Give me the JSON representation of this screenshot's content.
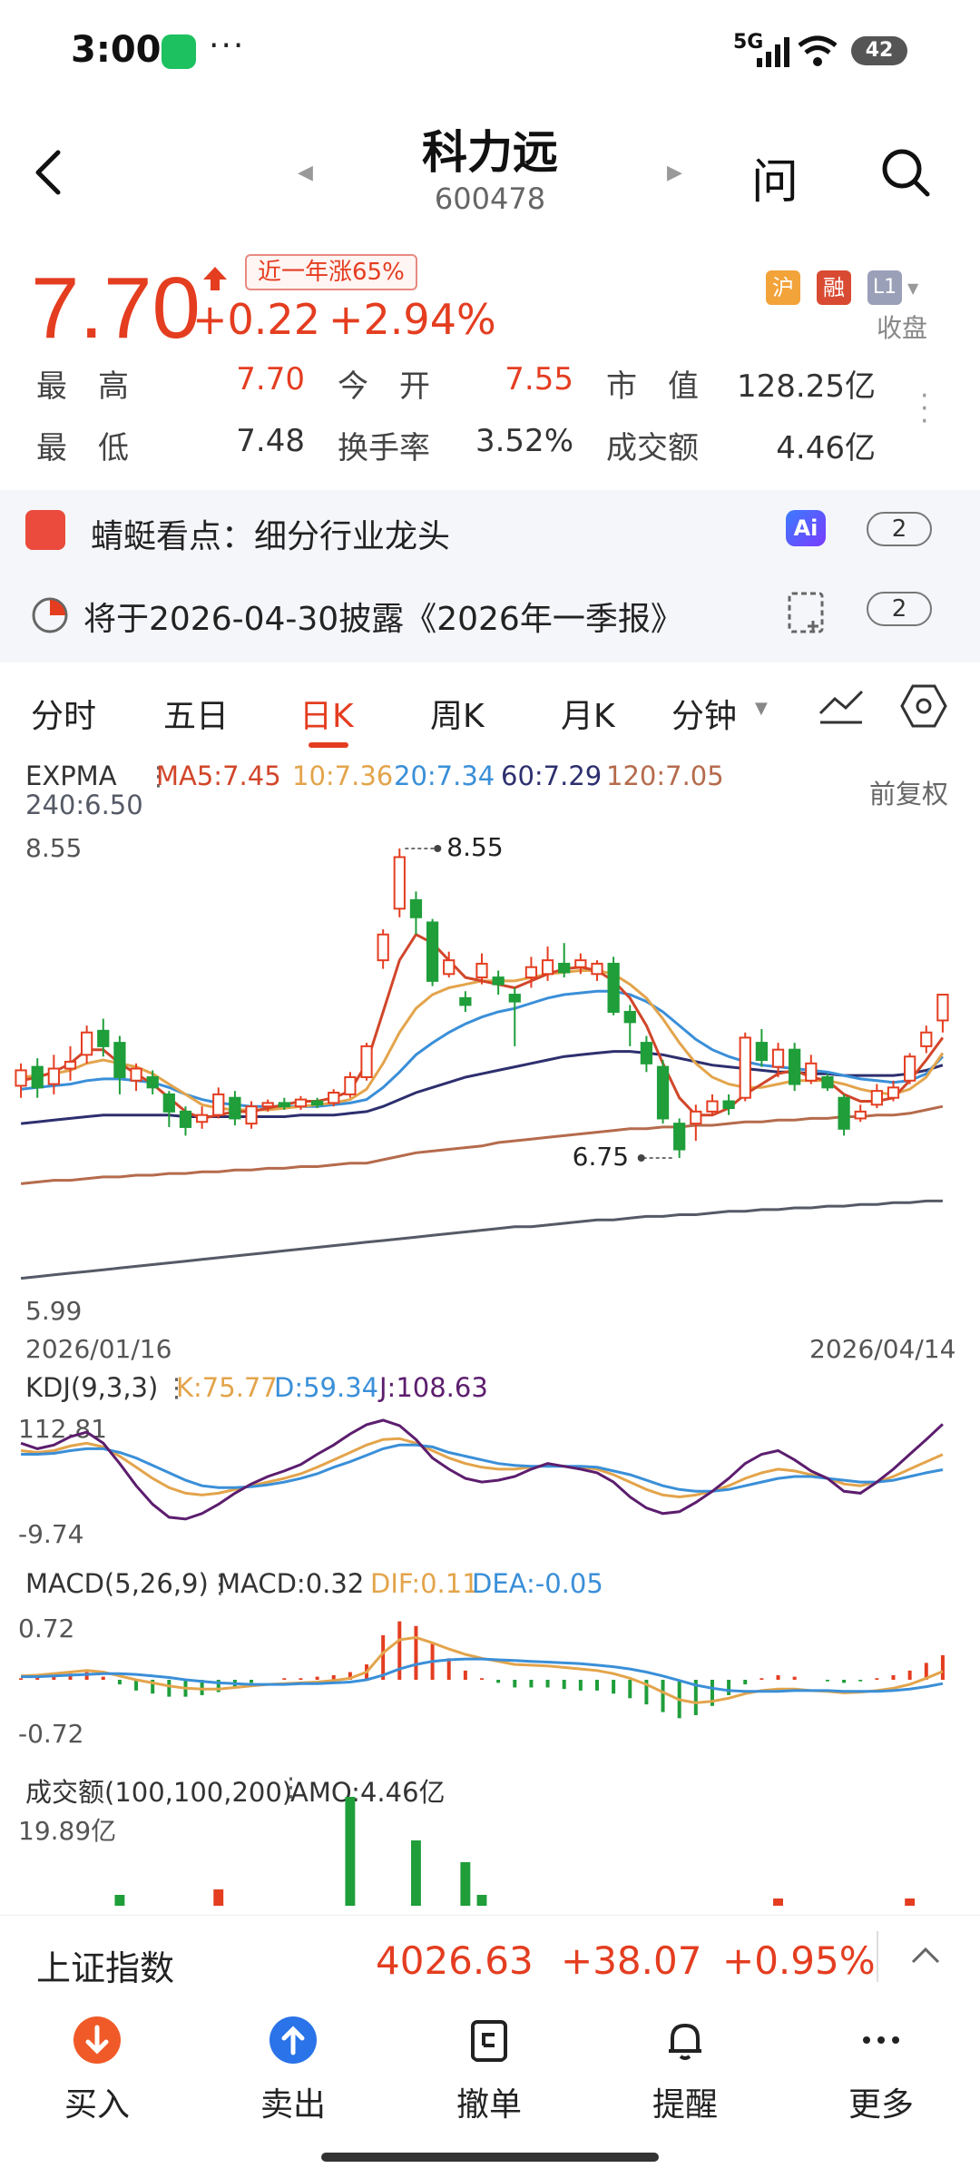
{
  "status": {
    "time": "3:00",
    "network": "5G",
    "battery": "42"
  },
  "header": {
    "name": "科力远",
    "code": "600478",
    "ask": "问"
  },
  "quote": {
    "price": "7.70",
    "year_tag": "近一年涨65%",
    "change": "+0.22",
    "change_pct": "+2.94%",
    "tags": [
      "沪",
      "融",
      "L1"
    ],
    "close_status": "收盘",
    "stats": [
      {
        "label": "最　高",
        "value": "7.70",
        "color": "#e43d20"
      },
      {
        "label": "今　开",
        "value": "7.55",
        "color": "#e43d20"
      },
      {
        "label": "市　值",
        "value": "128.25亿",
        "color": "#333333"
      },
      {
        "label": "最　低",
        "value": "7.48",
        "color": "#333333"
      },
      {
        "label": "换手率",
        "value": "3.52%",
        "color": "#333333"
      },
      {
        "label": "成交额",
        "value": "4.46亿",
        "color": "#333333"
      }
    ]
  },
  "news": [
    {
      "text": "蜻蜓看点：细分行业龙头",
      "count": "2"
    },
    {
      "text": "将于2026-04-30披露《2026年一季报》",
      "count": "2"
    }
  ],
  "tabs": [
    "分时",
    "五日",
    "日K",
    "周K",
    "月K",
    "分钟"
  ],
  "active_tab": "日K",
  "expma": {
    "label": "EXPMA",
    "values": [
      "MA5:7.45",
      "10:7.36",
      "20:7.34",
      "60:7.29",
      "120:7.05",
      "240:6.50"
    ],
    "colors": [
      "#d1462a",
      "#e3a44b",
      "#3a8fd8",
      "#2d2f6e",
      "#b56b4c",
      "#555a66"
    ],
    "adjust": "前复权"
  },
  "kline_axis": {
    "high": "8.55",
    "low": "5.99",
    "max_mark": "8.55",
    "min_mark": "6.75",
    "start_date": "2026/01/16",
    "end_date": "2026/04/14"
  },
  "kdj": {
    "label": "KDJ(9,3,3)",
    "k": "K:75.77",
    "d": "D:59.34",
    "j": "J:108.63",
    "top": "112.81",
    "bottom": "-9.74"
  },
  "macd": {
    "label": "MACD(5,26,9)",
    "macd": "MACD:0.32",
    "dif": "DIF:0.11",
    "dea": "DEA:-0.05",
    "top": "0.72",
    "bottom": "-0.72"
  },
  "amount": {
    "label": "成交额(100,100,200)",
    "amo": "AMO:4.46亿",
    "top": "19.89亿"
  },
  "index_bar": {
    "name": "上证指数",
    "value": "4026.63",
    "change": "+38.07",
    "pct": "+0.95%"
  },
  "bottom_nav": [
    "买入",
    "卖出",
    "撤单",
    "提醒",
    "更多"
  ],
  "chart_data": {
    "type": "candlestick",
    "title": "",
    "x_range": [
      "2026/01/16",
      "2026/04/14"
    ],
    "y_range": [
      5.99,
      8.55
    ],
    "candles": [
      {
        "o": 7.17,
        "c": 7.26,
        "h": 7.3,
        "l": 7.1
      },
      {
        "o": 7.28,
        "c": 7.16,
        "h": 7.33,
        "l": 7.1
      },
      {
        "o": 7.18,
        "c": 7.27,
        "h": 7.35,
        "l": 7.12
      },
      {
        "o": 7.27,
        "c": 7.31,
        "h": 7.4,
        "l": 7.2
      },
      {
        "o": 7.35,
        "c": 7.48,
        "h": 7.52,
        "l": 7.3
      },
      {
        "o": 7.49,
        "c": 7.4,
        "h": 7.56,
        "l": 7.34
      },
      {
        "o": 7.42,
        "c": 7.22,
        "h": 7.46,
        "l": 7.12
      },
      {
        "o": 7.2,
        "c": 7.27,
        "h": 7.3,
        "l": 7.14
      },
      {
        "o": 7.22,
        "c": 7.16,
        "h": 7.26,
        "l": 7.12
      },
      {
        "o": 7.12,
        "c": 7.02,
        "h": 7.14,
        "l": 6.93
      },
      {
        "o": 7.02,
        "c": 6.93,
        "h": 7.05,
        "l": 6.88
      },
      {
        "o": 6.96,
        "c": 7.0,
        "h": 7.05,
        "l": 6.92
      },
      {
        "o": 7.0,
        "c": 7.12,
        "h": 7.16,
        "l": 6.98
      },
      {
        "o": 7.1,
        "c": 6.98,
        "h": 7.14,
        "l": 6.94
      },
      {
        "o": 6.95,
        "c": 7.05,
        "h": 7.08,
        "l": 6.92
      },
      {
        "o": 7.05,
        "c": 7.07,
        "h": 7.09,
        "l": 7.02
      },
      {
        "o": 7.07,
        "c": 7.05,
        "h": 7.1,
        "l": 7.03
      },
      {
        "o": 7.05,
        "c": 7.09,
        "h": 7.11,
        "l": 7.03
      },
      {
        "o": 7.08,
        "c": 7.06,
        "h": 7.1,
        "l": 7.04
      },
      {
        "o": 7.07,
        "c": 7.13,
        "h": 7.15,
        "l": 7.05
      },
      {
        "o": 7.12,
        "c": 7.22,
        "h": 7.25,
        "l": 7.1
      },
      {
        "o": 7.22,
        "c": 7.4,
        "h": 7.42,
        "l": 7.2
      },
      {
        "o": 7.9,
        "c": 8.05,
        "h": 8.08,
        "l": 7.85
      },
      {
        "o": 8.2,
        "c": 8.5,
        "h": 8.55,
        "l": 8.15
      },
      {
        "o": 8.25,
        "c": 8.15,
        "h": 8.3,
        "l": 8.05
      },
      {
        "o": 8.12,
        "c": 7.78,
        "h": 8.14,
        "l": 7.75
      },
      {
        "o": 7.82,
        "c": 7.9,
        "h": 7.95,
        "l": 7.8
      },
      {
        "o": 7.68,
        "c": 7.64,
        "h": 7.72,
        "l": 7.6
      },
      {
        "o": 7.8,
        "c": 7.88,
        "h": 7.94,
        "l": 7.76
      },
      {
        "o": 7.8,
        "c": 7.76,
        "h": 7.84,
        "l": 7.7
      },
      {
        "o": 7.7,
        "c": 7.66,
        "h": 7.74,
        "l": 7.4
      },
      {
        "o": 7.8,
        "c": 7.86,
        "h": 7.92,
        "l": 7.74
      },
      {
        "o": 7.82,
        "c": 7.9,
        "h": 7.98,
        "l": 7.78
      },
      {
        "o": 7.88,
        "c": 7.83,
        "h": 8.0,
        "l": 7.8
      },
      {
        "o": 7.86,
        "c": 7.9,
        "h": 7.94,
        "l": 7.82
      },
      {
        "o": 7.82,
        "c": 7.88,
        "h": 7.9,
        "l": 7.78
      },
      {
        "o": 7.88,
        "c": 7.6,
        "h": 7.92,
        "l": 7.58
      },
      {
        "o": 7.6,
        "c": 7.54,
        "h": 7.64,
        "l": 7.4
      },
      {
        "o": 7.42,
        "c": 7.3,
        "h": 7.46,
        "l": 7.25
      },
      {
        "o": 7.28,
        "c": 6.98,
        "h": 7.32,
        "l": 6.95
      },
      {
        "o": 6.95,
        "c": 6.8,
        "h": 6.98,
        "l": 6.75
      },
      {
        "o": 6.95,
        "c": 7.02,
        "h": 7.06,
        "l": 6.85
      },
      {
        "o": 7.02,
        "c": 7.08,
        "h": 7.12,
        "l": 7.0
      },
      {
        "o": 7.08,
        "c": 7.04,
        "h": 7.12,
        "l": 7.0
      },
      {
        "o": 7.1,
        "c": 7.45,
        "h": 7.48,
        "l": 7.08
      },
      {
        "o": 7.42,
        "c": 7.32,
        "h": 7.5,
        "l": 7.28
      },
      {
        "o": 7.28,
        "c": 7.38,
        "h": 7.42,
        "l": 7.22
      },
      {
        "o": 7.38,
        "c": 7.18,
        "h": 7.42,
        "l": 7.14
      },
      {
        "o": 7.2,
        "c": 7.3,
        "h": 7.35,
        "l": 7.18
      },
      {
        "o": 7.22,
        "c": 7.16,
        "h": 7.24,
        "l": 7.14
      },
      {
        "o": 7.1,
        "c": 6.92,
        "h": 7.12,
        "l": 6.88
      },
      {
        "o": 6.98,
        "c": 7.02,
        "h": 7.06,
        "l": 6.96
      },
      {
        "o": 7.06,
        "c": 7.14,
        "h": 7.18,
        "l": 7.04
      },
      {
        "o": 7.1,
        "c": 7.16,
        "h": 7.2,
        "l": 7.08
      },
      {
        "o": 7.2,
        "c": 7.34,
        "h": 7.36,
        "l": 7.18
      },
      {
        "o": 7.4,
        "c": 7.48,
        "h": 7.52,
        "l": 7.36
      },
      {
        "o": 7.55,
        "c": 7.7,
        "h": 7.7,
        "l": 7.48
      }
    ],
    "ma_series": [
      {
        "name": "MA5",
        "color": "#d1462a",
        "values": [
          7.2,
          7.22,
          7.25,
          7.3,
          7.38,
          7.38,
          7.3,
          7.24,
          7.18,
          7.1,
          7.02,
          6.98,
          7.0,
          7.02,
          7.02,
          7.04,
          7.06,
          7.08,
          7.08,
          7.1,
          7.14,
          7.3,
          7.6,
          7.9,
          8.05,
          8.0,
          7.9,
          7.8,
          7.78,
          7.76,
          7.74,
          7.78,
          7.82,
          7.85,
          7.86,
          7.84,
          7.78,
          7.68,
          7.52,
          7.3,
          7.1,
          7.0,
          7.0,
          7.04,
          7.12,
          7.18,
          7.24,
          7.26,
          7.22,
          7.2,
          7.12,
          7.08,
          7.08,
          7.1,
          7.2,
          7.32,
          7.45
        ]
      },
      {
        "name": "10",
        "color": "#e3a44b",
        "values": [
          7.22,
          7.23,
          7.24,
          7.26,
          7.3,
          7.32,
          7.3,
          7.28,
          7.24,
          7.18,
          7.12,
          7.06,
          7.04,
          7.03,
          7.03,
          7.03,
          7.04,
          7.05,
          7.06,
          7.07,
          7.09,
          7.15,
          7.3,
          7.48,
          7.62,
          7.7,
          7.74,
          7.76,
          7.78,
          7.78,
          7.78,
          7.8,
          7.82,
          7.83,
          7.84,
          7.84,
          7.82,
          7.76,
          7.68,
          7.56,
          7.42,
          7.3,
          7.22,
          7.18,
          7.16,
          7.16,
          7.18,
          7.2,
          7.2,
          7.2,
          7.18,
          7.15,
          7.13,
          7.12,
          7.15,
          7.22,
          7.36
        ]
      },
      {
        "name": "20",
        "color": "#3a8fd8",
        "values": [
          7.15,
          7.16,
          7.17,
          7.18,
          7.2,
          7.21,
          7.21,
          7.2,
          7.19,
          7.16,
          7.12,
          7.09,
          7.07,
          7.06,
          7.05,
          7.05,
          7.05,
          7.05,
          7.05,
          7.06,
          7.07,
          7.09,
          7.16,
          7.25,
          7.35,
          7.42,
          7.48,
          7.53,
          7.57,
          7.6,
          7.62,
          7.65,
          7.68,
          7.7,
          7.71,
          7.72,
          7.72,
          7.7,
          7.66,
          7.6,
          7.52,
          7.44,
          7.38,
          7.34,
          7.31,
          7.29,
          7.28,
          7.27,
          7.26,
          7.25,
          7.23,
          7.21,
          7.2,
          7.19,
          7.2,
          7.24,
          7.34
        ]
      },
      {
        "name": "60",
        "color": "#2d2f6e",
        "values": [
          6.95,
          6.96,
          6.97,
          6.98,
          6.99,
          7.0,
          7.0,
          7.0,
          7.0,
          7.0,
          6.99,
          6.99,
          6.99,
          6.99,
          6.99,
          6.99,
          6.99,
          7.0,
          7.0,
          7.0,
          7.01,
          7.02,
          7.05,
          7.09,
          7.13,
          7.16,
          7.19,
          7.22,
          7.24,
          7.26,
          7.28,
          7.3,
          7.32,
          7.34,
          7.35,
          7.36,
          7.37,
          7.37,
          7.36,
          7.35,
          7.33,
          7.31,
          7.29,
          7.28,
          7.27,
          7.26,
          7.25,
          7.25,
          7.24,
          7.24,
          7.23,
          7.23,
          7.23,
          7.23,
          7.24,
          7.26,
          7.29
        ]
      },
      {
        "name": "120",
        "color": "#b56b4c",
        "values": [
          6.6,
          6.61,
          6.62,
          6.62,
          6.63,
          6.64,
          6.64,
          6.65,
          6.65,
          6.66,
          6.66,
          6.67,
          6.67,
          6.68,
          6.68,
          6.69,
          6.69,
          6.7,
          6.7,
          6.71,
          6.72,
          6.72,
          6.74,
          6.76,
          6.78,
          6.79,
          6.8,
          6.81,
          6.82,
          6.84,
          6.85,
          6.86,
          6.87,
          6.88,
          6.89,
          6.9,
          6.91,
          6.92,
          6.92,
          6.93,
          6.93,
          6.94,
          6.94,
          6.95,
          6.96,
          6.96,
          6.97,
          6.97,
          6.98,
          6.98,
          6.99,
          6.99,
          7.0,
          7.0,
          7.01,
          7.03,
          7.05
        ]
      },
      {
        "name": "240",
        "color": "#555a66",
        "values": [
          6.05,
          6.06,
          6.07,
          6.08,
          6.09,
          6.1,
          6.11,
          6.12,
          6.13,
          6.14,
          6.15,
          6.16,
          6.17,
          6.18,
          6.19,
          6.2,
          6.21,
          6.22,
          6.23,
          6.24,
          6.25,
          6.26,
          6.27,
          6.28,
          6.29,
          6.3,
          6.31,
          6.32,
          6.33,
          6.34,
          6.35,
          6.35,
          6.36,
          6.37,
          6.38,
          6.39,
          6.39,
          6.4,
          6.41,
          6.41,
          6.42,
          6.42,
          6.43,
          6.44,
          6.44,
          6.45,
          6.45,
          6.46,
          6.46,
          6.47,
          6.47,
          6.48,
          6.48,
          6.49,
          6.49,
          6.5,
          6.5
        ]
      }
    ],
    "kdj_series": [
      {
        "name": "K",
        "color": "#e3a44b",
        "values": [
          80,
          78,
          80,
          85,
          88,
          84,
          74,
          62,
          50,
          40,
          34,
          32,
          34,
          38,
          42,
          46,
          50,
          55,
          62,
          70,
          78,
          86,
          92,
          93,
          88,
          80,
          72,
          66,
          62,
          60,
          60,
          62,
          64,
          63,
          62,
          60,
          54,
          46,
          38,
          32,
          30,
          32,
          36,
          42,
          50,
          56,
          60,
          58,
          54,
          50,
          44,
          42,
          46,
          52,
          60,
          68,
          75.77
        ]
      },
      {
        "name": "D",
        "color": "#3a8fd8",
        "values": [
          76,
          76,
          77,
          80,
          82,
          82,
          78,
          72,
          64,
          56,
          48,
          42,
          40,
          40,
          41,
          43,
          46,
          50,
          55,
          62,
          68,
          75,
          82,
          86,
          86,
          84,
          78,
          74,
          70,
          66,
          64,
          63,
          63,
          63,
          63,
          62,
          58,
          54,
          48,
          42,
          38,
          36,
          36,
          38,
          42,
          46,
          50,
          52,
          52,
          50,
          48,
          46,
          46,
          48,
          52,
          56,
          59.34
        ]
      },
      {
        "name": "J",
        "color": "#5c1d6e",
        "values": [
          88,
          82,
          86,
          95,
          100,
          88,
          66,
          42,
          22,
          8,
          6,
          12,
          22,
          34,
          44,
          52,
          58,
          65,
          76,
          86,
          98,
          108,
          112.81,
          107,
          92,
          72,
          60,
          50,
          46,
          48,
          52,
          60,
          66,
          63,
          60,
          56,
          46,
          30,
          18,
          12,
          14,
          24,
          36,
          50,
          66,
          76,
          80,
          70,
          58,
          50,
          36,
          34,
          46,
          60,
          76,
          92,
          108.63
        ]
      }
    ],
    "macd_series": [
      {
        "name": "DIF",
        "color": "#e3a44b",
        "values": [
          0.05,
          0.06,
          0.08,
          0.1,
          0.12,
          0.1,
          0.05,
          0.0,
          -0.04,
          -0.08,
          -0.11,
          -0.12,
          -0.12,
          -0.1,
          -0.08,
          -0.06,
          -0.05,
          -0.04,
          -0.03,
          -0.01,
          0.02,
          0.1,
          0.35,
          0.52,
          0.55,
          0.48,
          0.4,
          0.33,
          0.28,
          0.24,
          0.2,
          0.19,
          0.18,
          0.16,
          0.14,
          0.12,
          0.08,
          0.02,
          -0.06,
          -0.16,
          -0.26,
          -0.3,
          -0.28,
          -0.24,
          -0.18,
          -0.14,
          -0.12,
          -0.12,
          -0.14,
          -0.15,
          -0.17,
          -0.16,
          -0.14,
          -0.11,
          -0.06,
          0.02,
          0.11
        ]
      },
      {
        "name": "DEA",
        "color": "#3a8fd8",
        "values": [
          0.04,
          0.04,
          0.05,
          0.06,
          0.07,
          0.08,
          0.08,
          0.07,
          0.05,
          0.03,
          0.0,
          -0.02,
          -0.04,
          -0.05,
          -0.06,
          -0.06,
          -0.06,
          -0.05,
          -0.05,
          -0.04,
          -0.03,
          0.0,
          0.06,
          0.14,
          0.2,
          0.24,
          0.26,
          0.27,
          0.27,
          0.26,
          0.25,
          0.24,
          0.23,
          0.22,
          0.21,
          0.19,
          0.17,
          0.14,
          0.1,
          0.05,
          -0.01,
          -0.07,
          -0.11,
          -0.14,
          -0.15,
          -0.15,
          -0.15,
          -0.14,
          -0.14,
          -0.14,
          -0.15,
          -0.15,
          -0.15,
          -0.14,
          -0.12,
          -0.09,
          -0.05
        ]
      }
    ],
    "volume_tail": [
      2,
      3,
      20,
      12,
      8,
      2
    ]
  }
}
